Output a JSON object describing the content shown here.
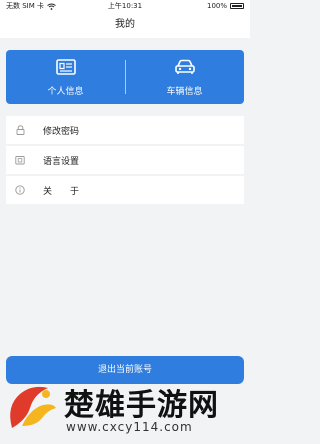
{
  "status_bar": {
    "carrier": "无数 SIM 卡",
    "time": "上午10:31",
    "battery": "100%"
  },
  "header": {
    "title": "我的"
  },
  "banner": {
    "left_label": "个人信息",
    "right_label": "车辆信息",
    "color": "#2e7ddf"
  },
  "menu": [
    {
      "label": "修改密码",
      "icon": "lock-icon"
    },
    {
      "label": "语言设置",
      "icon": "language-icon"
    },
    {
      "label": "关　　于",
      "icon": "info-icon"
    }
  ],
  "logout_label": "退出当前账号",
  "watermark": {
    "title": "楚雄手游网",
    "url": "www.cxcy114.com"
  }
}
